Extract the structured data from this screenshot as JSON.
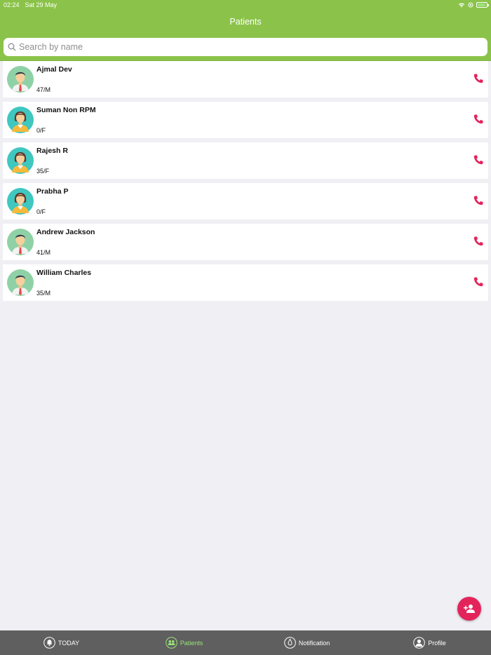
{
  "status_bar": {
    "time": "02:24",
    "date": "Sat 29 May"
  },
  "nav": {
    "title": "Patients"
  },
  "search": {
    "placeholder": "Search by name"
  },
  "patients": [
    {
      "name": "Ajmal Dev",
      "age_gender": "47/M",
      "gender": "male"
    },
    {
      "name": "Suman Non RPM",
      "age_gender": "0/F",
      "gender": "female"
    },
    {
      "name": "Rajesh R",
      "age_gender": "35/F",
      "gender": "female"
    },
    {
      "name": "Prabha P",
      "age_gender": "0/F",
      "gender": "female"
    },
    {
      "name": "Andrew Jackson",
      "age_gender": "41/M",
      "gender": "male"
    },
    {
      "name": "William Charles",
      "age_gender": "35/M",
      "gender": "male"
    }
  ],
  "tabs": [
    {
      "label": "TODAY",
      "icon": "bell-icon",
      "active": false
    },
    {
      "label": "Patients",
      "icon": "users-icon",
      "active": true
    },
    {
      "label": "Notification",
      "icon": "drop-icon",
      "active": false
    },
    {
      "label": "Profile",
      "icon": "person-icon",
      "active": false
    }
  ],
  "colors": {
    "brand": "#8bc34a",
    "accent": "#e3245b",
    "tab_bar": "#5f5f5f",
    "tab_active": "#9be27a"
  }
}
